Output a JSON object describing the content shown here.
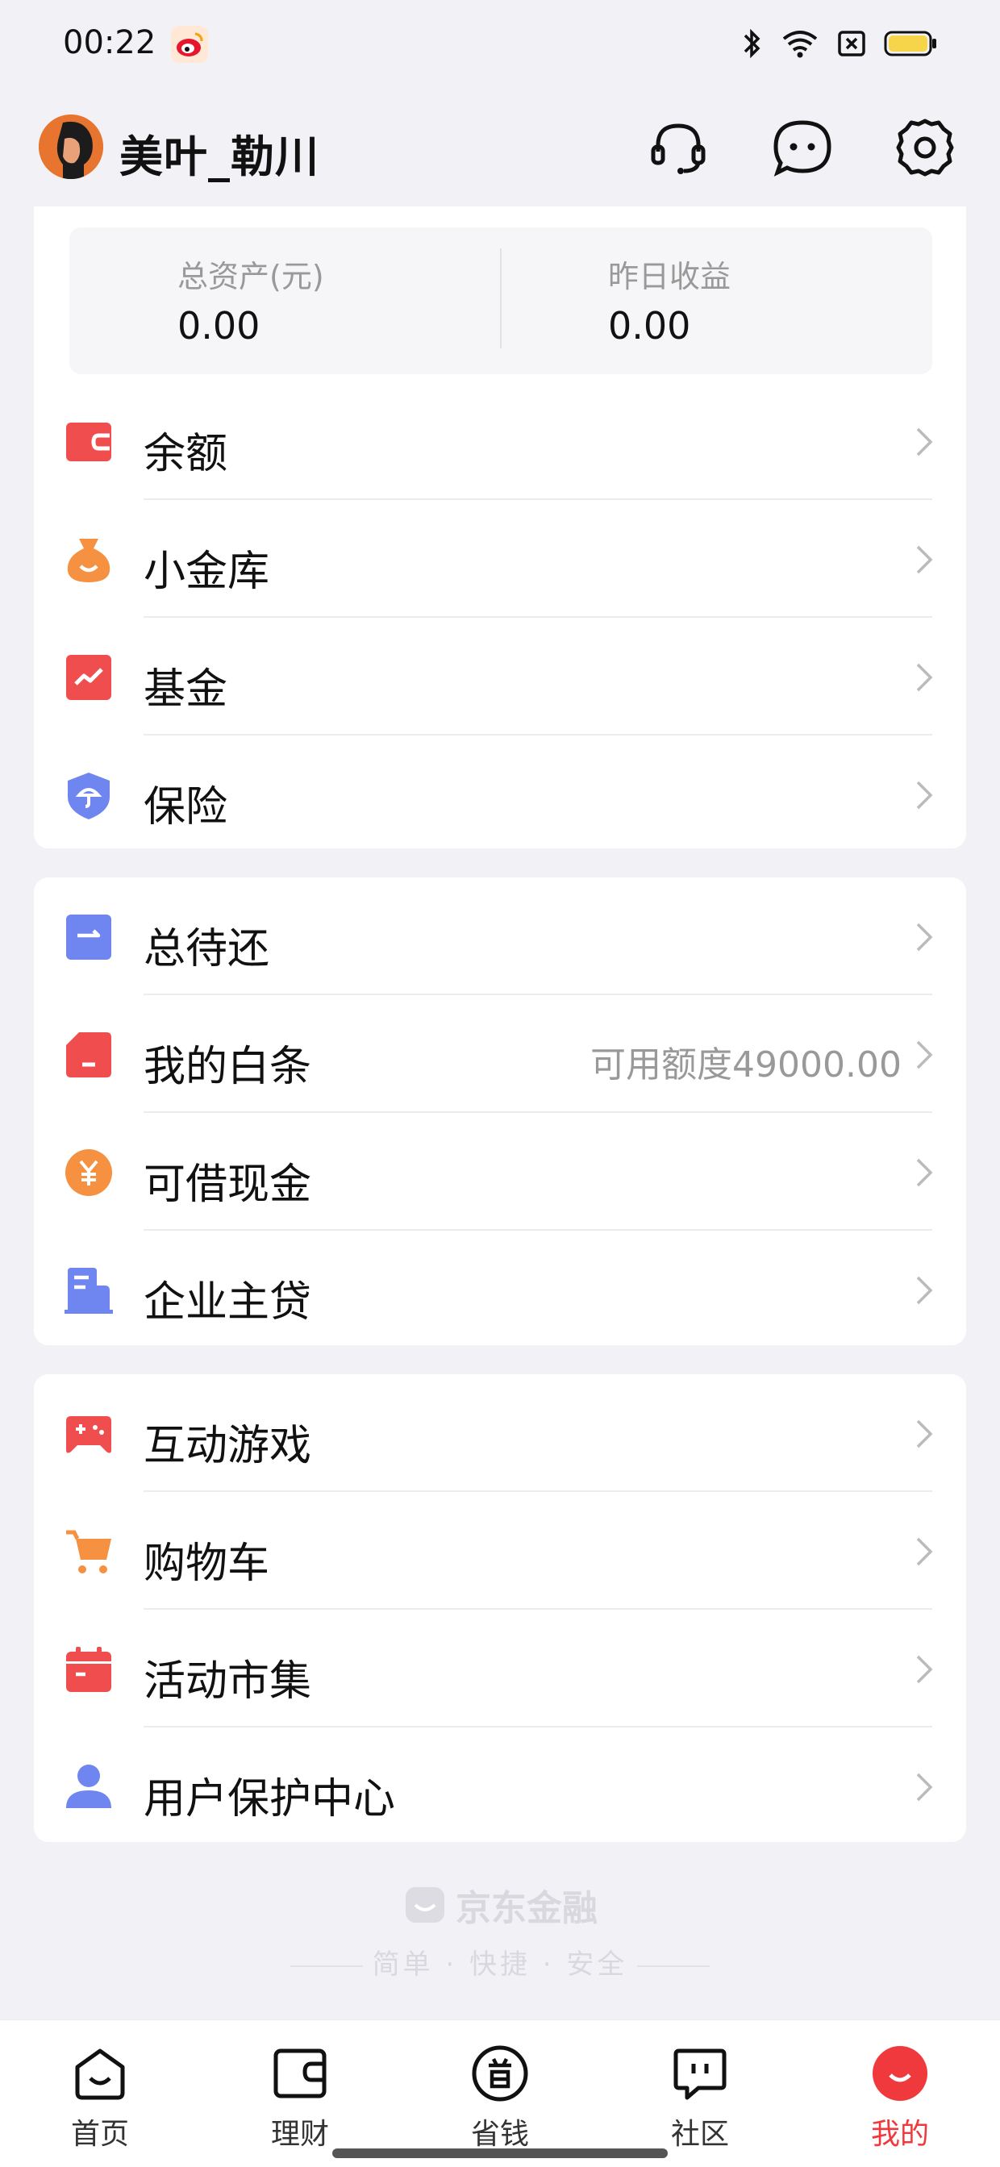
{
  "status_bar": {
    "time": "00:22"
  },
  "header": {
    "username": "美叶_勒川",
    "icons": [
      "headset-icon",
      "message-icon",
      "settings-icon"
    ]
  },
  "assets": {
    "total_label": "总资产(元)",
    "total_value": "0.00",
    "yesterday_label": "昨日收益",
    "yesterday_value": "0.00"
  },
  "wealth_items": [
    {
      "label": "余额",
      "icon": "wallet-icon"
    },
    {
      "label": "小金库",
      "icon": "money-bag-icon"
    },
    {
      "label": "基金",
      "icon": "fund-chart-icon"
    },
    {
      "label": "保险",
      "icon": "shield-umbrella-icon"
    }
  ],
  "credit_items": [
    {
      "label": "总待还",
      "icon": "repay-icon"
    },
    {
      "label": "我的白条",
      "icon": "baitiao-card-icon",
      "extra": "可用额度49000.00"
    },
    {
      "label": "可借现金",
      "icon": "yuan-coin-icon"
    },
    {
      "label": "企业主贷",
      "icon": "building-icon"
    }
  ],
  "other_items": [
    {
      "label": "互动游戏",
      "icon": "gamepad-icon"
    },
    {
      "label": "购物车",
      "icon": "cart-icon"
    },
    {
      "label": "活动市集",
      "icon": "calendar-icon"
    },
    {
      "label": "用户保护中心",
      "icon": "user-icon"
    }
  ],
  "brand": {
    "name": "京东金融",
    "slogan": "简单 · 快捷 · 安全"
  },
  "tabs": [
    {
      "label": "首页",
      "icon": "home-icon"
    },
    {
      "label": "理财",
      "icon": "wallet-tab-icon"
    },
    {
      "label": "省钱",
      "icon": "save-money-icon"
    },
    {
      "label": "社区",
      "icon": "community-icon"
    },
    {
      "label": "我的",
      "icon": "profile-icon",
      "active": true
    }
  ],
  "colors": {
    "accent_red": "#f0393c",
    "icon_red": "#f04e4e",
    "icon_orange": "#f59140",
    "icon_blue": "#6f85ef",
    "background": "#f2f2f6"
  }
}
